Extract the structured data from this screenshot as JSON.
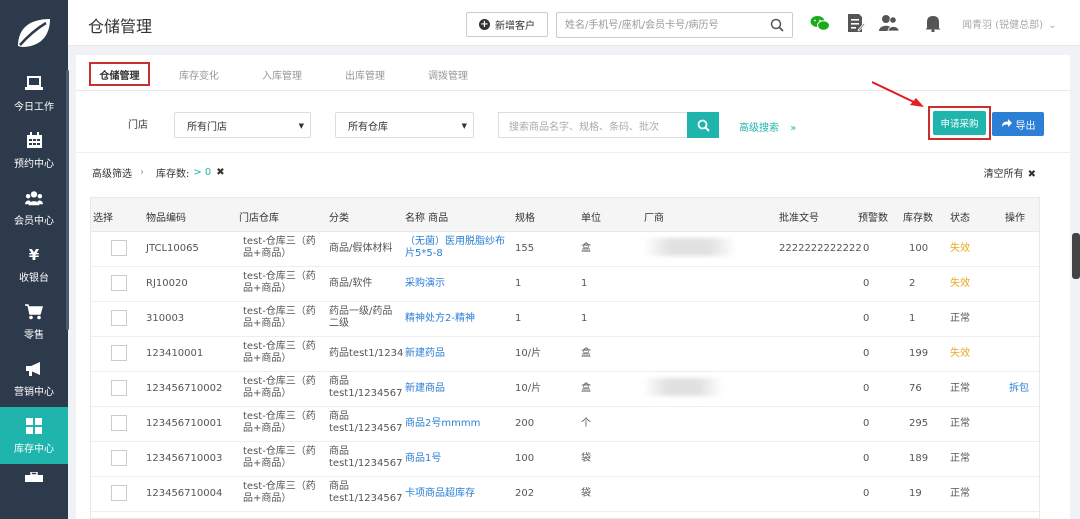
{
  "sidebar": {
    "items": [
      {
        "label": "今日工作",
        "icon": "laptop-icon"
      },
      {
        "label": "预约中心",
        "icon": "calendar-icon"
      },
      {
        "label": "会员中心",
        "icon": "members-icon"
      },
      {
        "label": "收银台",
        "icon": "yen-icon"
      },
      {
        "label": "零售",
        "icon": "cart-icon"
      },
      {
        "label": "营销中心",
        "icon": "megaphone-icon"
      },
      {
        "label": "库存中心",
        "icon": "grid-icon"
      }
    ],
    "active_index": 6
  },
  "header": {
    "title": "仓储管理",
    "new_customer": "新增客户",
    "search_placeholder": "姓名/手机号/座机/会员卡号/病历号",
    "user": "闻青羽 (锐健总部)"
  },
  "tabs": [
    "仓储管理",
    "库存变化",
    "入库管理",
    "出库管理",
    "调拨管理"
  ],
  "filters": {
    "store_label": "门店",
    "store_select": "所有门店",
    "warehouse_select": "所有仓库",
    "goods_search_placeholder": "搜索商品名字、规格、条码、批次",
    "advanced_search": "高级搜索",
    "apply_purchase": "申请采购",
    "export": "导出"
  },
  "advanced": {
    "label": "高级筛选",
    "stock_label": "库存数:",
    "stock_value": "> 0",
    "clear_all": "清空所有"
  },
  "table": {
    "columns": [
      "选择",
      "物品编码",
      "门店仓库",
      "分类",
      "名称 商品",
      "规格",
      "单位",
      "厂商",
      "批准文号",
      "预警数",
      "库存数",
      "状态",
      "操作"
    ],
    "rows": [
      {
        "code": "JTCL10065",
        "store1": "test-仓库三（药",
        "store2": "品+商品）",
        "cat1": "商品/假体材料",
        "cat2": "",
        "name1": "（无菌）医用脱脂纱布",
        "name2": "片5*5-8",
        "spec": "155",
        "unit": "盒",
        "approval": "2222222222222",
        "alert": "0",
        "stock": "100",
        "status": "失效",
        "op": ""
      },
      {
        "code": "RJ10020",
        "store1": "test-仓库三（药",
        "store2": "品+商品）",
        "cat1": "商品/软件",
        "cat2": "",
        "name1": "采购演示",
        "name2": "",
        "spec": "1",
        "unit": "1",
        "approval": "",
        "alert": "0",
        "stock": "2",
        "status": "失效",
        "op": ""
      },
      {
        "code": "310003",
        "store1": "test-仓库三（药",
        "store2": "品+商品）",
        "cat1": "药品一级/药品",
        "cat2": "二级",
        "name1": "精神处方2-精神",
        "name2": "",
        "spec": "1",
        "unit": "1",
        "approval": "",
        "alert": "0",
        "stock": "1",
        "status": "正常",
        "op": ""
      },
      {
        "code": "123410001",
        "store1": "test-仓库三（药",
        "store2": "品+商品）",
        "cat1": "药品test1/1234",
        "cat2": "",
        "name1": "新建药品",
        "name2": "",
        "spec": "10/片",
        "unit": "盒",
        "approval": "",
        "alert": "0",
        "stock": "199",
        "status": "失效",
        "op": ""
      },
      {
        "code": "123456710002",
        "store1": "test-仓库三（药",
        "store2": "品+商品）",
        "cat1": "商品",
        "cat2": "test1/1234567",
        "name1": "新建商品",
        "name2": "",
        "spec": "10/片",
        "unit": "盒",
        "approval": "",
        "alert": "0",
        "stock": "76",
        "status": "正常",
        "op": "拆包"
      },
      {
        "code": "123456710001",
        "store1": "test-仓库三（药",
        "store2": "品+商品）",
        "cat1": "商品",
        "cat2": "test1/1234567",
        "name1": "商品2号mmmm",
        "name2": "",
        "spec": "200",
        "unit": "个",
        "approval": "",
        "alert": "0",
        "stock": "295",
        "status": "正常",
        "op": ""
      },
      {
        "code": "123456710003",
        "store1": "test-仓库三（药",
        "store2": "品+商品）",
        "cat1": "商品",
        "cat2": "test1/1234567",
        "name1": "商品1号",
        "name2": "",
        "spec": "100",
        "unit": "袋",
        "approval": "",
        "alert": "0",
        "stock": "189",
        "status": "正常",
        "op": ""
      },
      {
        "code": "123456710004",
        "store1": "test-仓库三（药",
        "store2": "品+商品）",
        "cat1": "商品",
        "cat2": "test1/1234567",
        "name1": "卡项商品超库存",
        "name2": "",
        "spec": "202",
        "unit": "袋",
        "approval": "",
        "alert": "0",
        "stock": "19",
        "status": "正常",
        "op": ""
      }
    ]
  },
  "colors": {
    "sidebar": "#2d3a4b",
    "accent": "#1fb5ac",
    "link": "#2b7fd4",
    "warning": "#e8a81e",
    "highlight": "#c9302c"
  }
}
